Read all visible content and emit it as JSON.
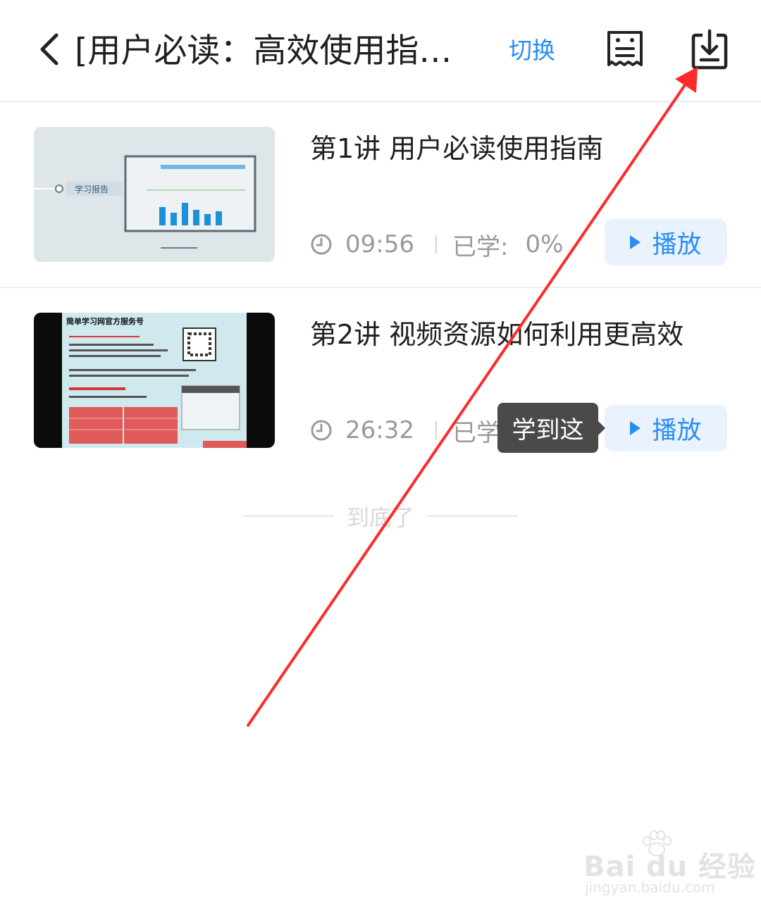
{
  "header": {
    "title": "[用户必读：高效使用指…",
    "switch_label": "切换",
    "notes_icon": "notes-icon",
    "download_icon": "download-icon",
    "back_icon": "chevron-left-icon"
  },
  "lessons": [
    {
      "title": "第1讲 用户必读使用指南",
      "duration": "09:56",
      "progress_label": "已学:",
      "progress_value": "0%",
      "play_label": "播放",
      "thumb_text": "学习报告"
    },
    {
      "title": "第2讲 视频资源如何利用更高效",
      "duration": "26:32",
      "progress_label": "已学:",
      "play_label": "播放",
      "thumb_text": "简单学习网官方服务号",
      "tooltip": "学到这"
    }
  ],
  "footer": {
    "end_text": "到底了"
  },
  "watermark": {
    "brand": "Bai du 经验",
    "url": "jingyan.baidu.com"
  },
  "colors": {
    "accent": "#2a8df5",
    "annotation_arrow": "#ff2a2a",
    "tooltip_bg": "#4a4a4a"
  }
}
